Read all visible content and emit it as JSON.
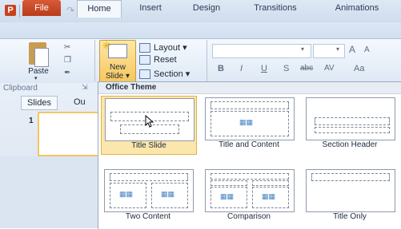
{
  "tabs": [
    {
      "label": "File"
    },
    {
      "label": "Home"
    },
    {
      "label": "Insert"
    },
    {
      "label": "Design"
    },
    {
      "label": "Transitions"
    },
    {
      "label": "Animations"
    }
  ],
  "clipboard": {
    "paste_label": "Paste",
    "group_label": "Clipboard"
  },
  "slides_group": {
    "new_slide_label_line1": "New",
    "new_slide_label_line2": "Slide",
    "layout_label": "Layout",
    "reset_label": "Reset",
    "section_label": "Section"
  },
  "font_group": {
    "bold": "B",
    "italic": "I",
    "underline": "U",
    "shadow": "S",
    "strike": "abc",
    "spacing": "AV",
    "case": "Aa",
    "grow": "A",
    "shrink": "A"
  },
  "left_pane": {
    "tab_slides": "Slides",
    "tab_outline": "Ou",
    "slide_number": "1"
  },
  "gallery": {
    "header": "Office Theme",
    "layouts": [
      {
        "label": "Title Slide",
        "selected": true
      },
      {
        "label": "Title and Content",
        "selected": false
      },
      {
        "label": "Section Header",
        "selected": false
      },
      {
        "label": "Two Content",
        "selected": false
      },
      {
        "label": "Comparison",
        "selected": false
      },
      {
        "label": "Title Only",
        "selected": false
      }
    ]
  },
  "colors": {
    "file_tab": "#c8421e",
    "selection_fill": "#fbe6ab",
    "selection_border": "#e3b344"
  }
}
